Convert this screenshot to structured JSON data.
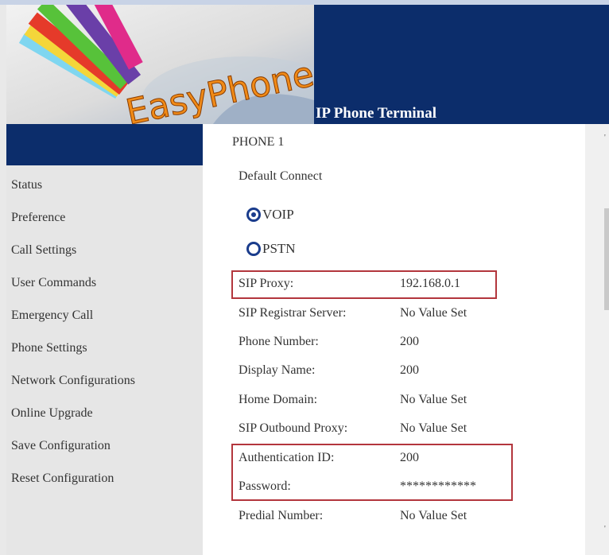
{
  "brand": {
    "logo_text": "EasyPhone",
    "title": "IP Phone Terminal"
  },
  "sidebar": {
    "items": [
      {
        "label": "Status"
      },
      {
        "label": "Preference"
      },
      {
        "label": "Call Settings"
      },
      {
        "label": "User Commands"
      },
      {
        "label": "Emergency Call"
      },
      {
        "label": "Phone Settings"
      },
      {
        "label": "Network Configurations"
      },
      {
        "label": "Online Upgrade"
      },
      {
        "label": "Save Configuration"
      },
      {
        "label": "Reset Configuration"
      }
    ]
  },
  "content": {
    "heading": "PHONE 1",
    "default_connect_label": "Default Connect",
    "options": [
      {
        "label": "VOIP",
        "selected": true
      },
      {
        "label": "PSTN",
        "selected": false
      }
    ],
    "fields": [
      {
        "label": "SIP Proxy:",
        "value": "192.168.0.1"
      },
      {
        "label": "SIP Registrar Server:",
        "value": "No Value Set"
      },
      {
        "label": "Phone Number:",
        "value": "200"
      },
      {
        "label": "Display Name:",
        "value": "200"
      },
      {
        "label": "Home Domain:",
        "value": "No Value Set"
      },
      {
        "label": "SIP Outbound Proxy:",
        "value": "No Value Set"
      },
      {
        "label": "Authentication ID:",
        "value": "200"
      },
      {
        "label": "Password:",
        "value": "************"
      },
      {
        "label": "Predial Number:",
        "value": "No Value Set"
      }
    ]
  },
  "colors": {
    "banner": "#0c2d6b",
    "highlight": "#b3363d",
    "radio": "#1a3c8c"
  }
}
